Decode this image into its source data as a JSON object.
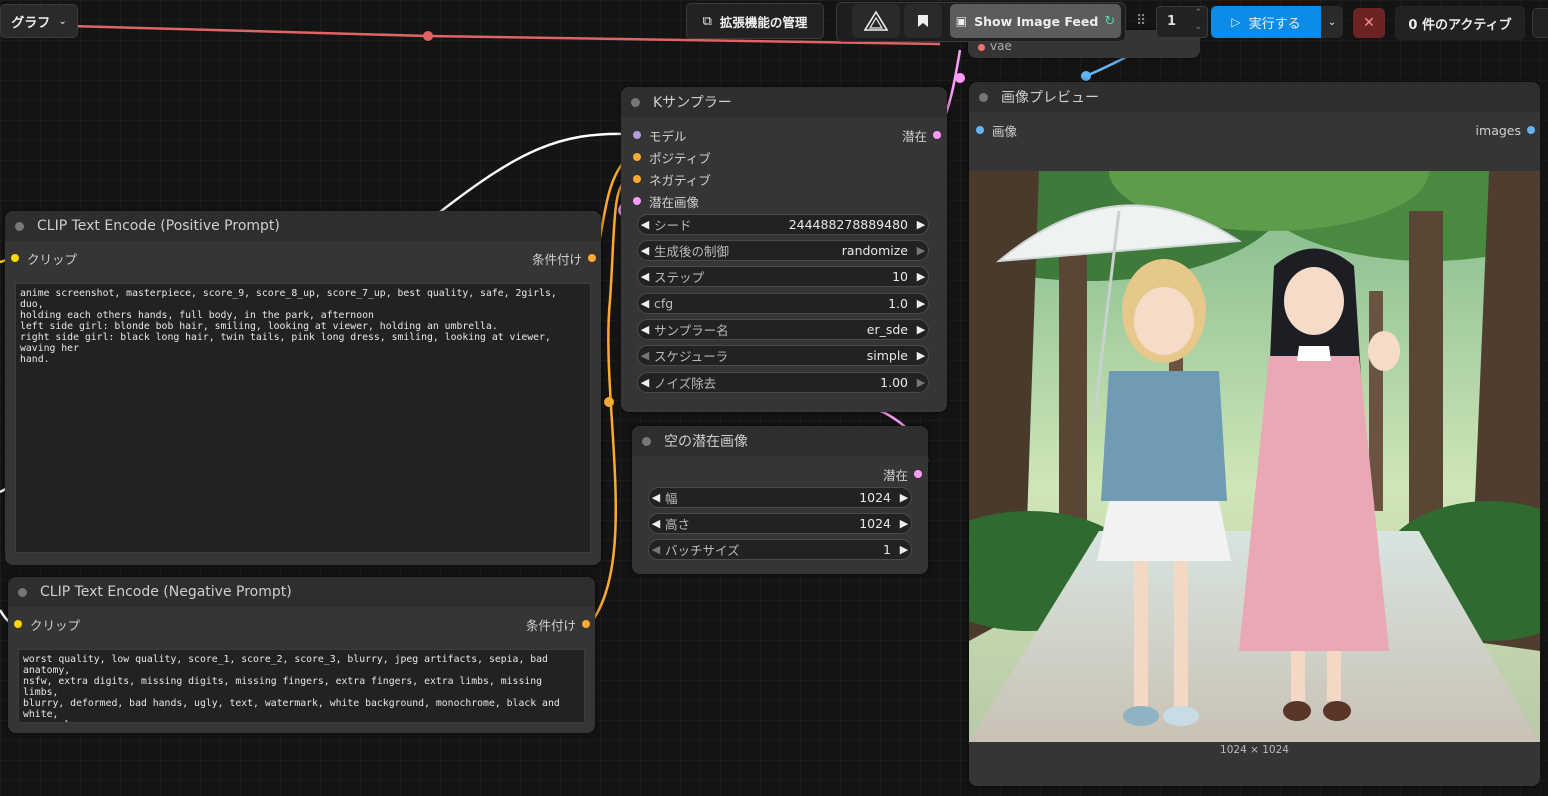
{
  "topbar": {
    "graph_menu_label": "グラフ",
    "manage_extensions_label": "拡張機能の管理",
    "show_image_feed_label": "Show Image Feed",
    "queue_count": "1",
    "run_label": "実行する",
    "active_label": "0 件のアクティブ"
  },
  "hidden_node": {
    "vae_label": "vae"
  },
  "ksampler": {
    "title": "Kサンプラー",
    "inputs": [
      "モデル",
      "ポジティブ",
      "ネガティブ",
      "潜在画像"
    ],
    "output": "潜在",
    "widgets": [
      {
        "label": "シード",
        "value": "244488278889480"
      },
      {
        "label": "生成後の制御",
        "value": "randomize"
      },
      {
        "label": "ステップ",
        "value": "10"
      },
      {
        "label": "cfg",
        "value": "1.0"
      },
      {
        "label": "サンプラー名",
        "value": "er_sde"
      },
      {
        "label": "スケジューラ",
        "value": "simple"
      },
      {
        "label": "ノイズ除去",
        "value": "1.00"
      }
    ]
  },
  "empty_latent": {
    "title": "空の潜在画像",
    "output": "潜在",
    "widgets": [
      {
        "label": "幅",
        "value": "1024"
      },
      {
        "label": "高さ",
        "value": "1024"
      },
      {
        "label": "バッチサイズ",
        "value": "1"
      }
    ]
  },
  "clip_positive": {
    "title": "CLIP Text Encode (Positive Prompt)",
    "input": "クリップ",
    "output": "条件付け",
    "text": "anime screenshot, masterpiece, score_9, score_8_up, score_7_up, best quality, safe, 2girls, duo,\nholding each others hands, full body, in the park, afternoon\nleft side girl: blonde bob hair, smiling, looking at viewer, holding an umbrella.\nright side girl: black long hair, twin tails, pink long dress, smiling, looking at viewer, waving her\nhand."
  },
  "clip_negative": {
    "title": "CLIP Text Encode (Negative Prompt)",
    "input": "クリップ",
    "output": "条件付け",
    "text": "worst quality, low quality, score_1, score_2, score_3, blurry, jpeg artifacts, sepia, bad anatomy,\nnsfw, extra digits, missing digits, missing fingers, extra fingers, extra limbs, missing limbs,\nblurry, deformed, bad hands, ugly, text, watermark, white background, monochrome, black and white,\ngrayscale"
  },
  "preview": {
    "title": "画像プレビュー",
    "input": "画像",
    "output": "images",
    "size_label": "1024 × 1024"
  },
  "colors": {
    "model": "#b39ddb",
    "conditioning": "#ffa931",
    "latent": "#ff9cf9",
    "clip": "#ffd500",
    "image": "#64b5f6",
    "vae": "#ff6e6e",
    "run_button": "#0b8ce9",
    "cancel_button": "#6b2323"
  }
}
